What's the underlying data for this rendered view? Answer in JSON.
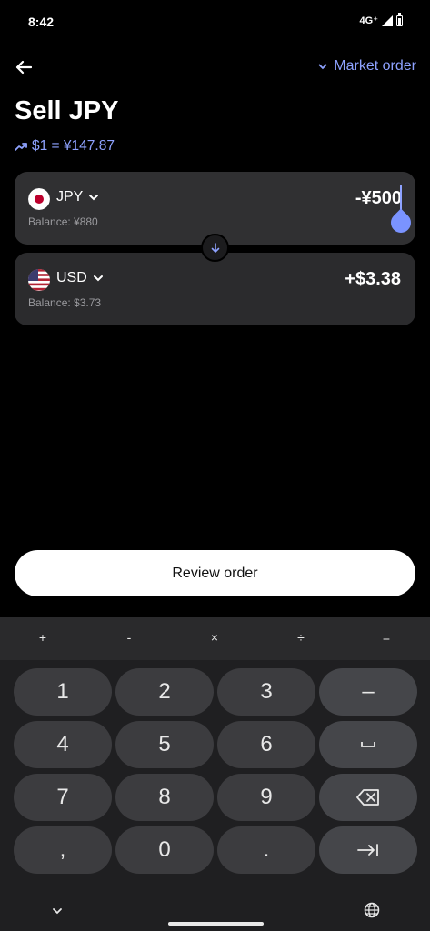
{
  "status_bar": {
    "time": "8:42",
    "network": "4G⁺"
  },
  "header": {
    "order_type": "Market order"
  },
  "title": "Sell JPY",
  "rate": "$1 = ¥147.87",
  "from": {
    "currency": "JPY",
    "balance": "Balance: ¥880",
    "amount": "-¥500"
  },
  "to": {
    "currency": "USD",
    "balance": "Balance: $3.73",
    "amount": "+$3.38"
  },
  "review_button": "Review order",
  "keyboard": {
    "ops": [
      "+",
      "-",
      "×",
      "÷",
      "="
    ],
    "keys": [
      "1",
      "2",
      "3",
      "–",
      "4",
      "5",
      "6",
      "␣",
      "7",
      "8",
      "9",
      "⌫",
      ",",
      "0",
      ".",
      "→|"
    ]
  },
  "colors": {
    "accent": "#8ea2ff",
    "card": "#2b2b2d",
    "background": "#000000"
  }
}
